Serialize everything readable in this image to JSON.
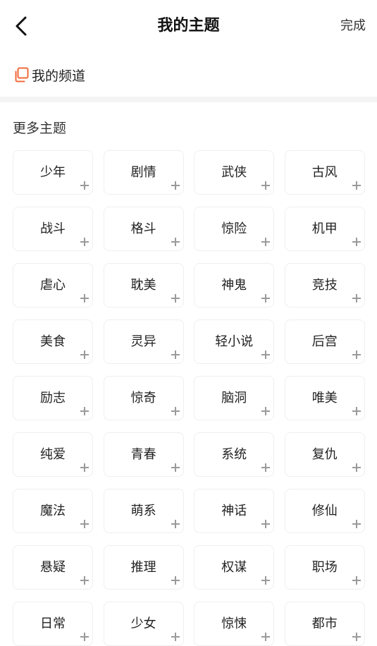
{
  "header": {
    "title": "我的主题",
    "done_label": "完成"
  },
  "my_channel": {
    "label": "我的频道",
    "icon": "copy-icon",
    "accent_color": "#f26a3a"
  },
  "more_topics": {
    "title": "更多主题",
    "items": [
      "少年",
      "剧情",
      "武侠",
      "古风",
      "战斗",
      "格斗",
      "惊险",
      "机甲",
      "虐心",
      "耽美",
      "神鬼",
      "竞技",
      "美食",
      "灵异",
      "轻小说",
      "后宫",
      "励志",
      "惊奇",
      "脑洞",
      "唯美",
      "纯爱",
      "青春",
      "系统",
      "复仇",
      "魔法",
      "萌系",
      "神话",
      "修仙",
      "悬疑",
      "推理",
      "权谋",
      "职场",
      "日常",
      "少女",
      "惊悚",
      "都市"
    ]
  }
}
